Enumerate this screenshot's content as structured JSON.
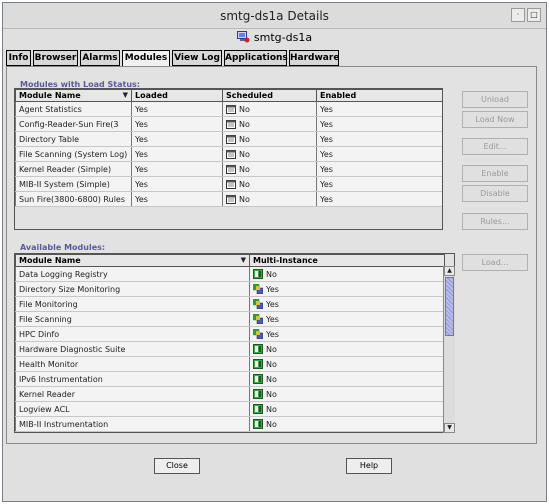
{
  "window": {
    "title": "smtg-ds1a Details"
  },
  "header": {
    "host_label": "smtg-ds1a"
  },
  "tabs": [
    {
      "label": "Info"
    },
    {
      "label": "Browser"
    },
    {
      "label": "Alarms"
    },
    {
      "label": "Modules"
    },
    {
      "label": "View Log"
    },
    {
      "label": "Applications"
    },
    {
      "label": "Hardware"
    }
  ],
  "active_tab": "Modules",
  "loaded_section": {
    "label": "Modules with Load Status:",
    "columns": [
      "Module Name",
      "Loaded",
      "Scheduled",
      "Enabled"
    ],
    "rows": [
      {
        "name": "Agent Statistics",
        "loaded": "Yes",
        "scheduled": "No",
        "enabled": "Yes"
      },
      {
        "name": "Config-Reader-Sun Fire(3",
        "loaded": "Yes",
        "scheduled": "No",
        "enabled": "Yes"
      },
      {
        "name": "Directory Table",
        "loaded": "Yes",
        "scheduled": "No",
        "enabled": "Yes"
      },
      {
        "name": "File Scanning (System Log)",
        "loaded": "Yes",
        "scheduled": "No",
        "enabled": "Yes"
      },
      {
        "name": "Kernel Reader (Simple)",
        "loaded": "Yes",
        "scheduled": "No",
        "enabled": "Yes"
      },
      {
        "name": "MIB-II System (Simple)",
        "loaded": "Yes",
        "scheduled": "No",
        "enabled": "Yes"
      },
      {
        "name": "Sun Fire(3800-6800) Rules",
        "loaded": "Yes",
        "scheduled": "No",
        "enabled": "Yes"
      }
    ]
  },
  "side_buttons": {
    "unload": "Unload",
    "load_now": "Load Now",
    "edit": "Edit...",
    "enable": "Enable",
    "disable": "Disable",
    "rules": "Rules...",
    "load": "Load..."
  },
  "available_section": {
    "label": "Available Modules:",
    "columns": [
      "Module Name",
      "Multi-Instance"
    ],
    "rows": [
      {
        "name": "Data Logging Registry",
        "multi": "No",
        "icon": "module-single-icon"
      },
      {
        "name": "Directory Size Monitoring",
        "multi": "Yes",
        "icon": "module-multi-icon"
      },
      {
        "name": "File Monitoring",
        "multi": "Yes",
        "icon": "module-multi-icon"
      },
      {
        "name": "File Scanning",
        "multi": "Yes",
        "icon": "module-multi-icon"
      },
      {
        "name": "HPC Dinfo",
        "multi": "Yes",
        "icon": "module-multi-icon"
      },
      {
        "name": "Hardware Diagnostic Suite",
        "multi": "No",
        "icon": "module-single-icon"
      },
      {
        "name": "Health Monitor",
        "multi": "No",
        "icon": "module-single-icon"
      },
      {
        "name": "IPv6 Instrumentation",
        "multi": "No",
        "icon": "module-single-icon"
      },
      {
        "name": "Kernel Reader",
        "multi": "No",
        "icon": "module-single-icon"
      },
      {
        "name": "Logview ACL",
        "multi": "No",
        "icon": "module-single-icon"
      },
      {
        "name": "MIB-II Instrumentation",
        "multi": "No",
        "icon": "module-single-icon"
      }
    ]
  },
  "bottom_buttons": {
    "close": "Close",
    "help": "Help"
  },
  "colors": {
    "section_label": "#5a5a9a",
    "scroll_thumb": "#8f96d6"
  }
}
